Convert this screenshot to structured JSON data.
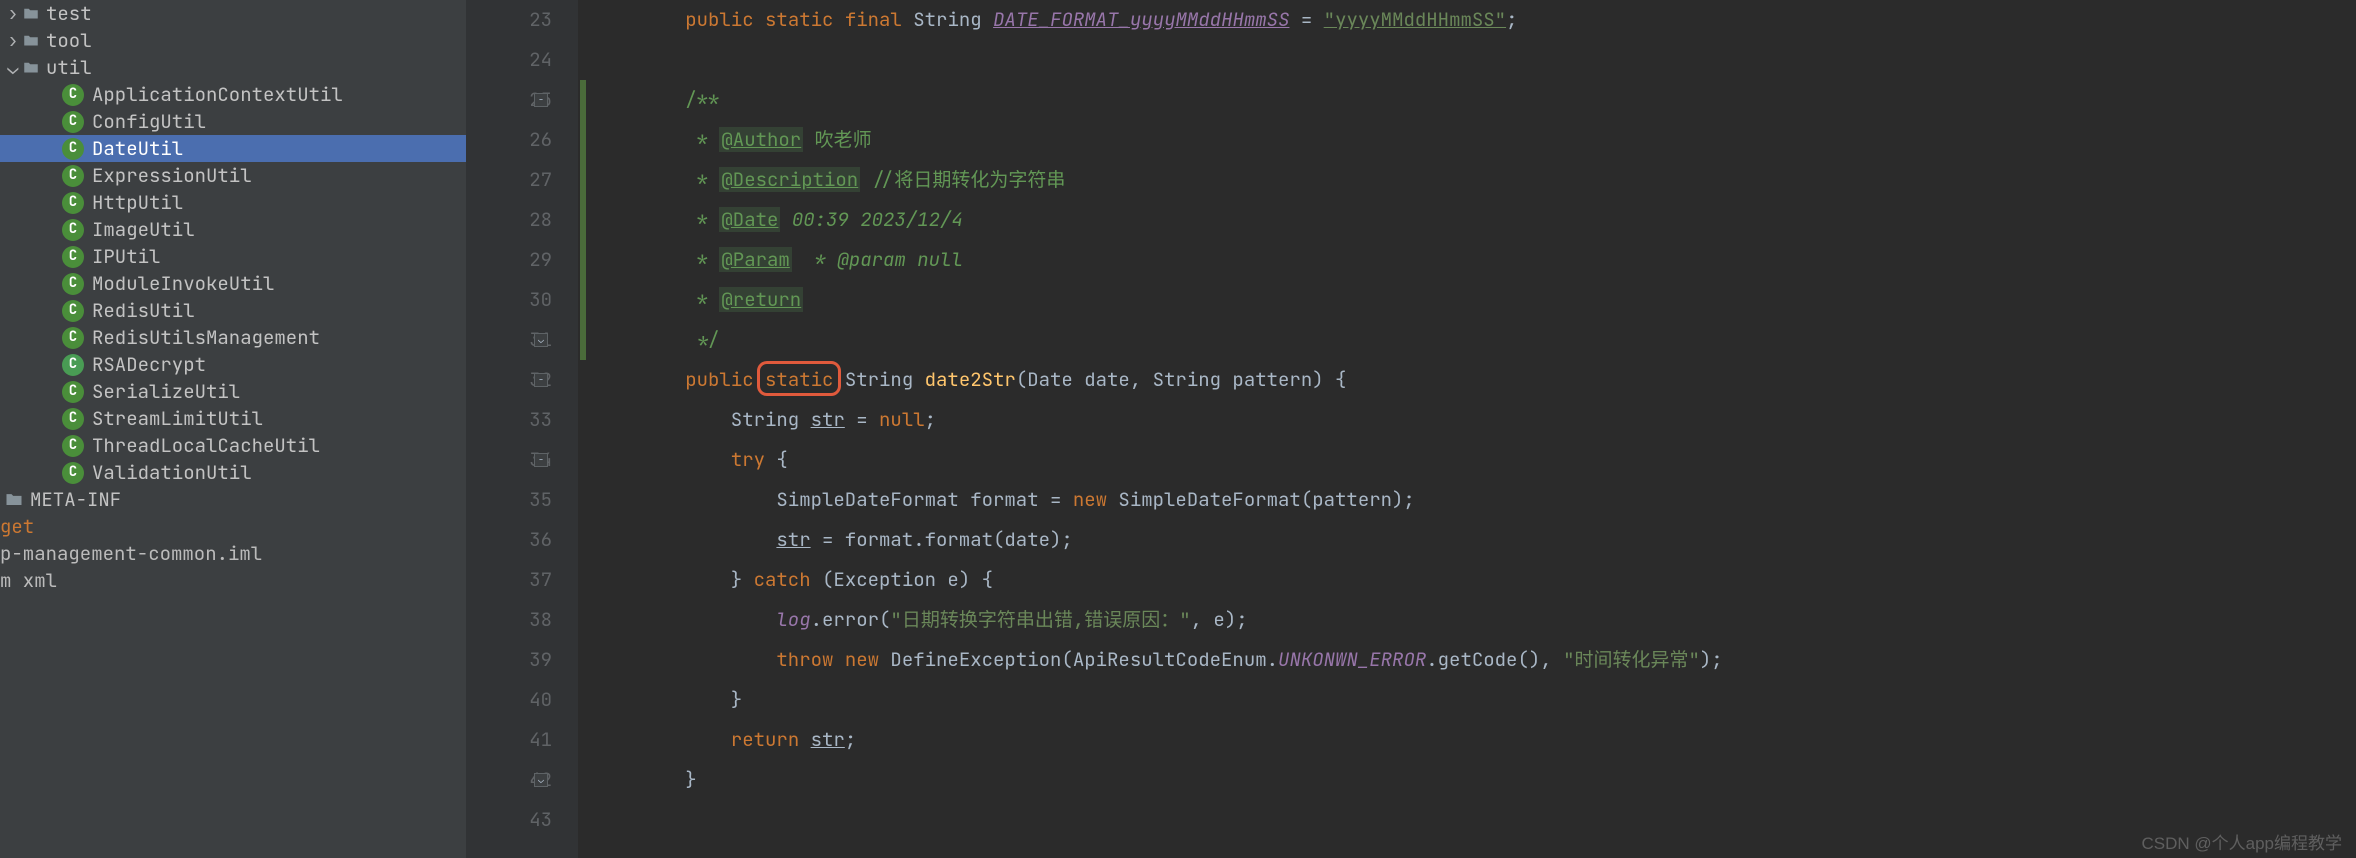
{
  "sidebar": {
    "folders": [
      {
        "name": "test",
        "expanded": false,
        "chevron": "›"
      },
      {
        "name": "tool",
        "expanded": false,
        "chevron": "›"
      },
      {
        "name": "util",
        "expanded": true,
        "chevron": "⌄"
      }
    ],
    "utilChildren": [
      "ApplicationContextUtil",
      "ConfigUtil",
      "DateUtil",
      "ExpressionUtil",
      "HttpUtil",
      "ImageUtil",
      "IPUtil",
      "ModuleInvokeUtil",
      "RedisUtil",
      "RedisUtilsManagement",
      "RSADecrypt",
      "SerializeUtil",
      "StreamLimitUtil",
      "ThreadLocalCacheUtil",
      "ValidationUtil"
    ],
    "selected": "DateUtil",
    "altIcon": "RSADecrypt",
    "metaInf": "META-INF",
    "getRow": "get",
    "cutRows": [
      "p-management-common.iml",
      "m xml"
    ]
  },
  "gutter": {
    "start": 23,
    "end": 43
  },
  "code": {
    "l23": {
      "public": "public",
      "static": "static",
      "final": "final",
      "type": "String",
      "name": "DATE_FORMAT_yyyyMMddHHmmSS",
      "eq": " = ",
      "val": "\"yyyyMMddHHmmSS\"",
      "semi": ";"
    },
    "l24": "",
    "l25": "/**",
    "l26": {
      "star": " * ",
      "tag": "@Author",
      "rest": " 吹老师"
    },
    "l27": {
      "star": " * ",
      "tag": "@Description",
      "rest": " //将日期转化为字符串"
    },
    "l28": {
      "star": " * ",
      "tag": "@Date",
      "rest": " 00:39 2023/12/4"
    },
    "l29": {
      "star": " * ",
      "tag": "@Param",
      "rest": "  * @param null"
    },
    "l30": {
      "star": " * ",
      "tag": "@return",
      "rest": ""
    },
    "l31": " */",
    "l32": {
      "public": "public",
      "static": "static",
      "type": " String ",
      "fn": "date2Str",
      "params": "(Date date, String pattern) {"
    },
    "l33": {
      "pre": "    String ",
      "str": "str",
      "rest": " = ",
      "null": "null",
      "semi": ";"
    },
    "l34": {
      "pre": "    ",
      "try": "try",
      "rest": " {"
    },
    "l35": {
      "pre": "        SimpleDateFormat format = ",
      "new": "new",
      "rest": " SimpleDateFormat(pattern);"
    },
    "l36": {
      "pre": "        ",
      "str": "str",
      "rest": " = format.format(date);"
    },
    "l37": {
      "pre": "    } ",
      "catch": "catch",
      "rest": " (Exception e) {"
    },
    "l38": {
      "pre": "        ",
      "log": "log",
      "mid": ".error(",
      "s": "\"日期转换字符串出错,错误原因：\"",
      "rest": ", e);"
    },
    "l39": {
      "pre": "        ",
      "throw": "throw",
      "sp": " ",
      "new": "new",
      "rest": " DefineException(ApiResultCodeEnum.",
      "enum": "UNKONWN_ERROR",
      "rest2": ".getCode(), ",
      "s": "\"时间转化异常\"",
      "rest3": ");"
    },
    "l40": "    }",
    "l41": {
      "pre": "    ",
      "return": "return",
      "sp": " ",
      "str": "str",
      "semi": ";"
    },
    "l42": "}",
    "l43": ""
  },
  "watermark": "CSDN @个人app编程教学"
}
